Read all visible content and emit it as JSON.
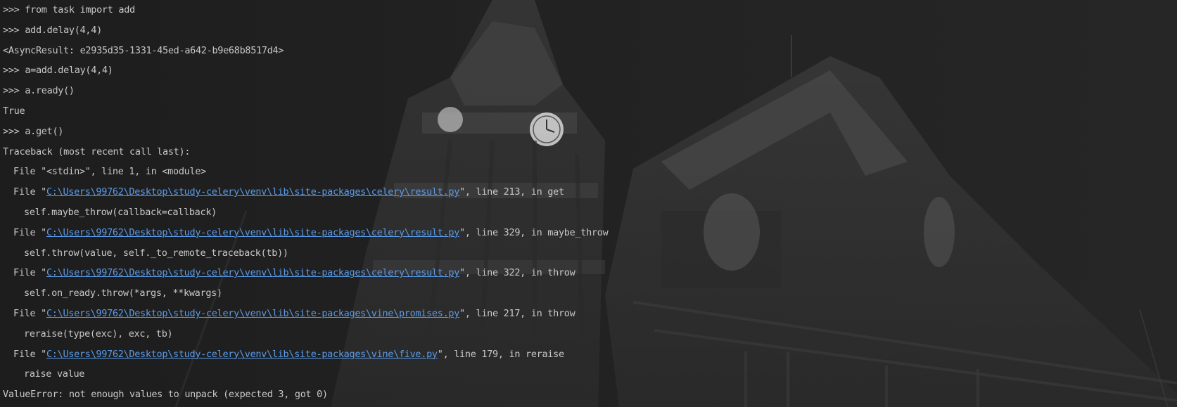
{
  "console": {
    "lines": [
      {
        "kind": "prompt",
        "prompt": ">>> ",
        "text": "from task import add"
      },
      {
        "kind": "prompt",
        "prompt": ">>> ",
        "text": "add.delay(4,4)"
      },
      {
        "kind": "output",
        "text": "<AsyncResult: e2935d35-1331-45ed-a642-b9e68b8517d4>"
      },
      {
        "kind": "prompt",
        "prompt": ">>> ",
        "text": "a=add.delay(4,4)"
      },
      {
        "kind": "prompt",
        "prompt": ">>> ",
        "text": "a.ready()"
      },
      {
        "kind": "output",
        "text": "True"
      },
      {
        "kind": "prompt",
        "prompt": ">>> ",
        "text": "a.get()"
      },
      {
        "kind": "output",
        "text": "Traceback (most recent call last):"
      },
      {
        "kind": "file_plain",
        "before": "File \"<stdin>\", line 1, in <module>"
      },
      {
        "kind": "file_link",
        "before": "File \"",
        "path": "C:\\Users\\99762\\Desktop\\study-celery\\venv\\lib\\site-packages\\celery\\result.py",
        "after": "\", line 213, in get"
      },
      {
        "kind": "code",
        "text": "self.maybe_throw(callback=callback)"
      },
      {
        "kind": "file_link",
        "before": "File \"",
        "path": "C:\\Users\\99762\\Desktop\\study-celery\\venv\\lib\\site-packages\\celery\\result.py",
        "after": "\", line 329, in maybe_throw"
      },
      {
        "kind": "code",
        "text": "self.throw(value, self._to_remote_traceback(tb))"
      },
      {
        "kind": "file_link",
        "before": "File \"",
        "path": "C:\\Users\\99762\\Desktop\\study-celery\\venv\\lib\\site-packages\\celery\\result.py",
        "after": "\", line 322, in throw"
      },
      {
        "kind": "code",
        "text": "self.on_ready.throw(*args, **kwargs)"
      },
      {
        "kind": "file_link",
        "before": "File \"",
        "path": "C:\\Users\\99762\\Desktop\\study-celery\\venv\\lib\\site-packages\\vine\\promises.py",
        "after": "\", line 217, in throw"
      },
      {
        "kind": "code",
        "text": "reraise(type(exc), exc, tb)"
      },
      {
        "kind": "file_link",
        "before": "File \"",
        "path": "C:\\Users\\99762\\Desktop\\study-celery\\venv\\lib\\site-packages\\vine\\five.py",
        "after": "\", line 179, in reraise"
      },
      {
        "kind": "code",
        "text": "raise value"
      },
      {
        "kind": "output",
        "text": "ValueError: not enough values to unpack (expected 3, got 0)"
      }
    ]
  },
  "theme": {
    "text_color": "#c8c8c8",
    "link_color": "#5b9be8",
    "background": "#1e1e1e"
  }
}
